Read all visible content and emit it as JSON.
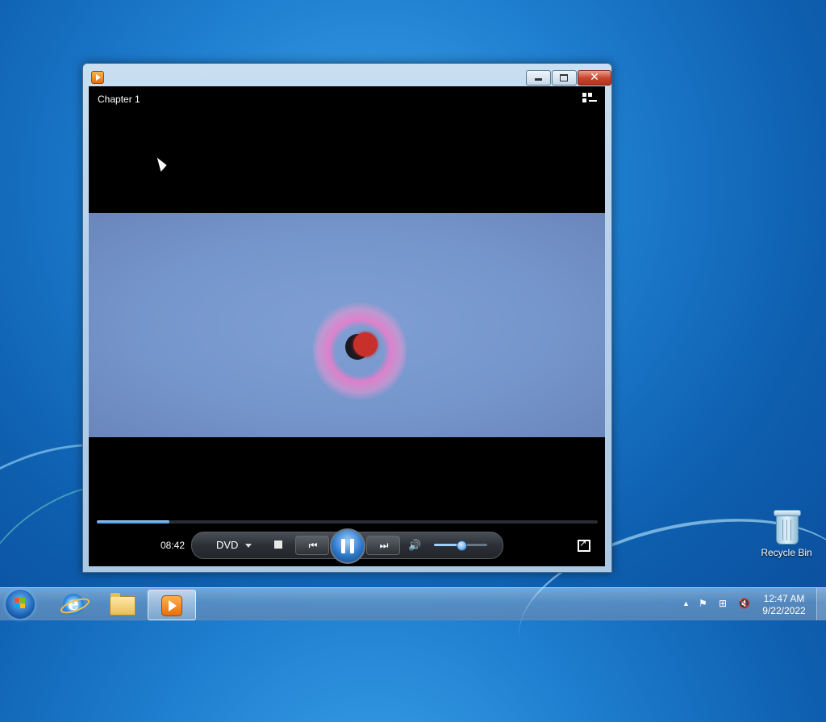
{
  "desktop": {
    "recycle_bin_label": "Recycle Bin"
  },
  "window": {
    "title": "",
    "chapter_label": "Chapter 1",
    "close_glyph": "✕"
  },
  "player": {
    "elapsed_time": "08:42",
    "source_label": "DVD",
    "seek_progress": 0.145,
    "volume_level": 0.52,
    "prev_glyph": "⏮",
    "next_glyph": "⏭",
    "speaker_glyph": "🔊"
  },
  "taskbar": {
    "clock_time": "12:47 AM",
    "clock_date": "9/22/2022",
    "tray_glyphs": {
      "show_hidden": "▲",
      "flag": "⚑",
      "network": "⊞",
      "volume_muted": "🔇"
    },
    "pinned": [
      {
        "name": "Internet Explorer",
        "icon": "ie-icon"
      },
      {
        "name": "Windows Explorer",
        "icon": "folder-icon"
      },
      {
        "name": "Windows Media Player",
        "icon": "media-player-icon",
        "active": true
      }
    ]
  },
  "colors": {
    "accent_blue": "#3f8fd6",
    "close_red": "#c9472f",
    "desktop_blue": "#1f7fd0"
  }
}
